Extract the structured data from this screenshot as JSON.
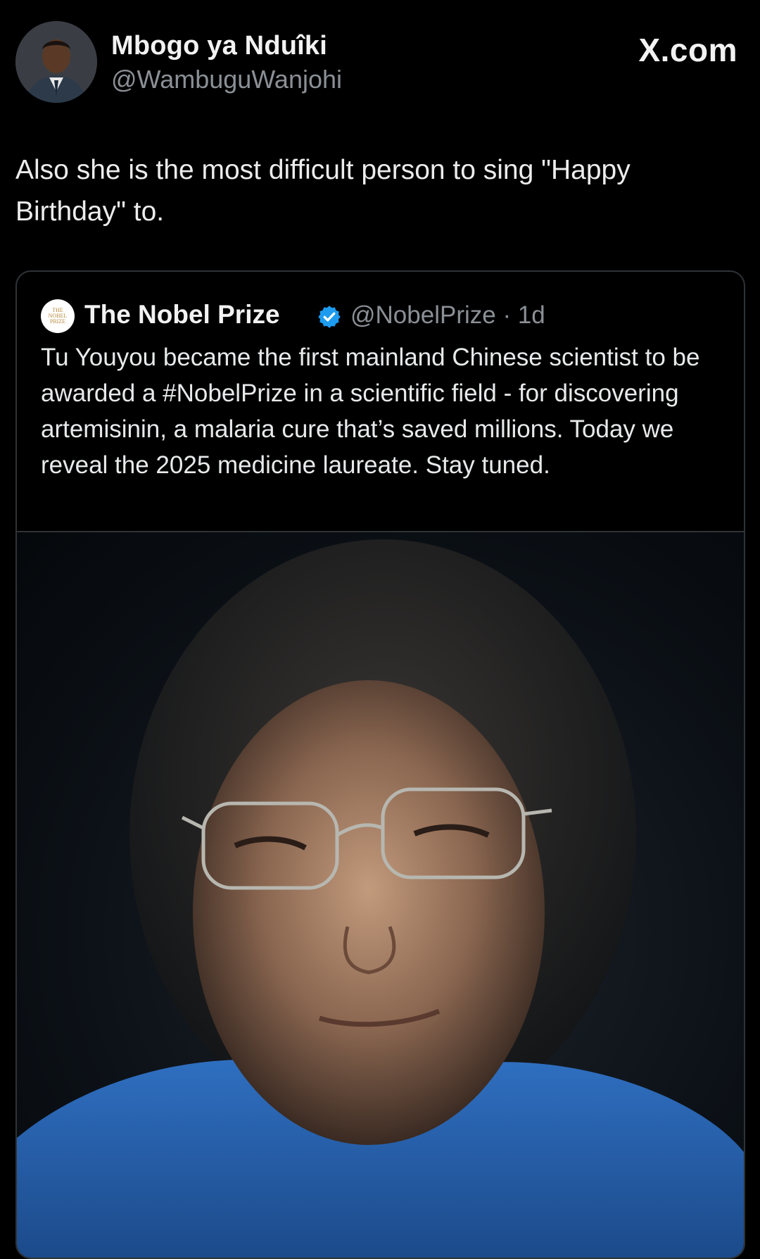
{
  "header": {
    "author_name": "Mbogo ya Nduîki",
    "author_handle": "@WambuguWanjohi",
    "site_label": "X.com",
    "avatar_icon": "profile-photo-man-in-suit"
  },
  "tweet": {
    "text": "Also she is the most difficult person to sing \"Happy Birthday\" to."
  },
  "quoted_tweet": {
    "author_name": "The Nobel Prize",
    "avatar_text": "THE\nNOBEL\nPRIZE",
    "verified_icon": "verified-badge-icon",
    "verified_color": "#1d9bf0",
    "handle_and_time": "@NobelPrize · 1d",
    "text": "Tu Youyou became the first mainland Chinese scientist to be awarded a #NobelPrize in a scientific field - for discovering artemisinin, a malaria cure that’s saved millions. Today we reveal the 2025 medicine laureate. Stay tuned.",
    "image_icon": "portrait-photo-elderly-woman-with-glasses"
  },
  "colors": {
    "background": "#000000",
    "primary_text": "#e7e9ea",
    "secondary_text": "#8b9096",
    "border": "#2f3336"
  }
}
